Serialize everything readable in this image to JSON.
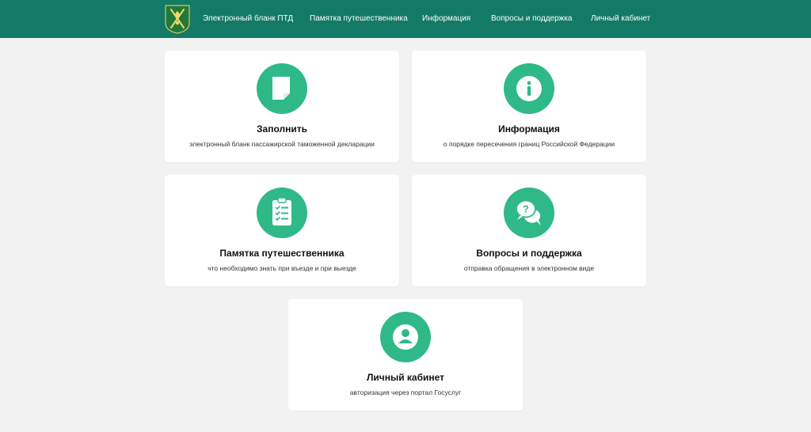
{
  "header": {
    "nav": [
      {
        "label": "Электронный бланк ПТД"
      },
      {
        "label": "Памятка путешественника"
      },
      {
        "label": "Информация"
      },
      {
        "label": "Вопросы и поддержка"
      },
      {
        "label": "Личный кабинет"
      }
    ]
  },
  "cards": [
    {
      "title": "Заполнить",
      "subtitle": "электронный бланк пассажирской таможенной декларации",
      "icon": "document-icon"
    },
    {
      "title": "Информация",
      "subtitle": "о порядке пересечения границ Российской Федерации",
      "icon": "info-icon"
    },
    {
      "title": "Памятка путешественника",
      "subtitle": "что необходимо знать при въезде и при выезде",
      "icon": "checklist-icon"
    },
    {
      "title": "Вопросы и поддержка",
      "subtitle": "отправка обращения в электронном виде",
      "icon": "question-chat-icon"
    },
    {
      "title": "Личный кабинет",
      "subtitle": "авторизация через портал Госуслуг",
      "icon": "user-icon"
    }
  ],
  "colors": {
    "header_bg": "#137a66",
    "accent": "#2fb989",
    "page_bg": "#f2f2f2",
    "card_bg": "#ffffff"
  }
}
